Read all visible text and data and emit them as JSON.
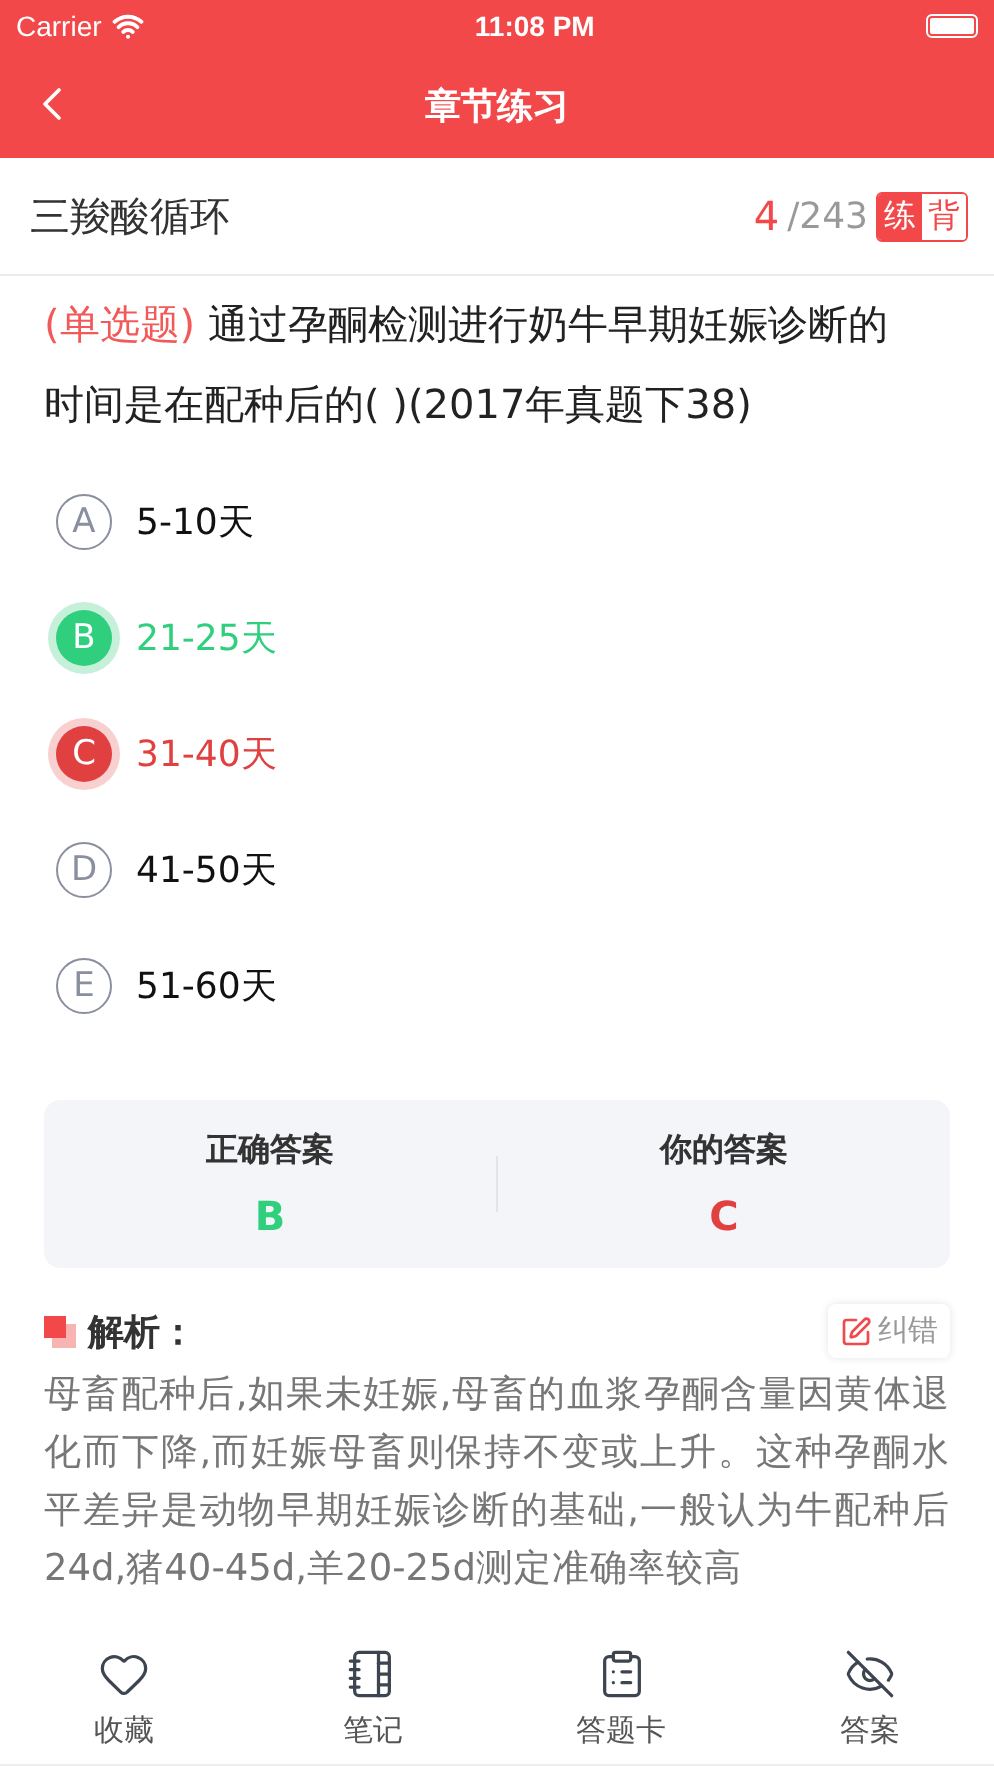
{
  "status_bar": {
    "carrier": "Carrier",
    "time": "11:08 PM"
  },
  "nav": {
    "title": "章节练习"
  },
  "chapter": {
    "title": "三羧酸循环",
    "current": "4",
    "total": "/243",
    "modes": [
      {
        "label": "练",
        "selected": true
      },
      {
        "label": "背",
        "selected": false
      }
    ]
  },
  "question": {
    "type": "(单选题)",
    "text": "通过孕酮检测进行奶牛早期妊娠诊断的时间是在配种后的( )(2017年真题下38)"
  },
  "options": [
    {
      "letter": "A",
      "text": "5-10天",
      "correct": false,
      "chosen": false
    },
    {
      "letter": "B",
      "text": "21-25天",
      "correct": true,
      "chosen": false
    },
    {
      "letter": "C",
      "text": "31-40天",
      "correct": false,
      "chosen": true
    },
    {
      "letter": "D",
      "text": "41-50天",
      "correct": false,
      "chosen": false
    },
    {
      "letter": "E",
      "text": "51-60天",
      "correct": false,
      "chosen": false
    }
  ],
  "answer_card": {
    "correct_label": "正确答案",
    "correct": "B",
    "yours_label": "你的答案",
    "yours": "C"
  },
  "analysis": {
    "title": "解析：",
    "report": "纠错",
    "text": "母畜配种后,如果未妊娠,母畜的血浆孕酮含量因黄体退化而下降,而妊娠母畜则保持不变或上升。这种孕酮水平差异是动物早期妊娠诊断的基础,一般认为牛配种后24d,猪40-45d,羊20-25d测定准确率较高"
  },
  "tab_bar": [
    {
      "kind": "heart",
      "label": "收藏"
    },
    {
      "kind": "notebook",
      "label": "笔记"
    },
    {
      "kind": "clipboard",
      "label": "答题卡"
    },
    {
      "kind": "eye-off",
      "label": "答案"
    }
  ]
}
